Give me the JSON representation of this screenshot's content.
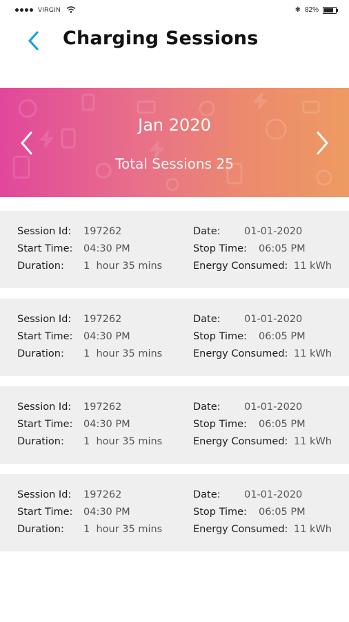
{
  "status_bar": {
    "carrier": "VIRGIN",
    "battery_percent": "82%",
    "battery_level": 0.82,
    "icons": [
      "signal-dots-icon",
      "wifi-icon",
      "bluetooth-icon",
      "battery-icon"
    ]
  },
  "header": {
    "title": "Charging Sessions",
    "back_icon": "chevron-left-icon",
    "accent_color": "#1ba1e2"
  },
  "banner": {
    "month": "Jan 2020",
    "total_sessions": "Total Sessions 25",
    "prev_icon": "chevron-left-icon",
    "next_icon": "chevron-right-icon",
    "gradient": [
      "#e1479b",
      "#ee9a63"
    ]
  },
  "sessions": [
    {
      "session_id_label": "Session Id:",
      "session_id": "197262",
      "start_label": "Start Time:",
      "start_time": "04:30 PM",
      "duration_label": "Duration:",
      "duration": "1  hour 35 mins",
      "date_label": "Date:",
      "date": "01-01-2020",
      "stop_label": "Stop Time:",
      "stop_time": "06:05 PM",
      "energy_label": "Energy Consumed:",
      "energy": "11 kWh"
    },
    {
      "session_id_label": "Session Id:",
      "session_id": "197262",
      "start_label": "Start Time:",
      "start_time": "04:30 PM",
      "duration_label": "Duration:",
      "duration": "1  hour 35 mins",
      "date_label": "Date:",
      "date": "01-01-2020",
      "stop_label": "Stop Time:",
      "stop_time": "06:05 PM",
      "energy_label": "Energy Consumed:",
      "energy": "11 kWh"
    },
    {
      "session_id_label": "Session Id:",
      "session_id": "197262",
      "start_label": "Start Time:",
      "start_time": "04:30 PM",
      "duration_label": "Duration:",
      "duration": "1  hour 35 mins",
      "date_label": "Date:",
      "date": "01-01-2020",
      "stop_label": "Stop Time:",
      "stop_time": "06:05 PM",
      "energy_label": "Energy Consumed:",
      "energy": "11 kWh"
    },
    {
      "session_id_label": "Session Id:",
      "session_id": "197262",
      "start_label": "Start Time:",
      "start_time": "04:30 PM",
      "duration_label": "Duration:",
      "duration": "1  hour 35 mins",
      "date_label": "Date:",
      "date": "01-01-2020",
      "stop_label": "Stop Time:",
      "stop_time": "06:05 PM",
      "energy_label": "Energy Consumed:",
      "energy": "11 kWh"
    }
  ]
}
